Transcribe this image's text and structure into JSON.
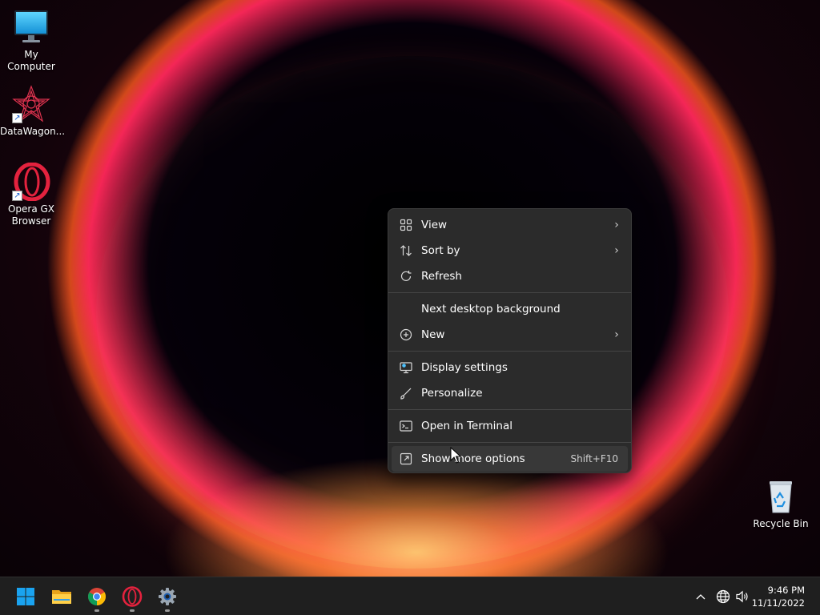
{
  "desktop": {
    "icons": [
      {
        "label": "My Computer",
        "icon": "monitor-icon"
      },
      {
        "label": "DataWagon...",
        "icon": "datawagon-logo-icon"
      },
      {
        "label": "Opera GX Browser",
        "icon": "opera-gx-icon"
      },
      {
        "label": "Recycle Bin",
        "icon": "recycle-bin-icon"
      }
    ]
  },
  "context_menu": {
    "items": [
      {
        "label": "View",
        "icon": "grid-icon",
        "has_submenu": true
      },
      {
        "label": "Sort by",
        "icon": "sort-icon",
        "has_submenu": true
      },
      {
        "label": "Refresh",
        "icon": "refresh-icon",
        "has_submenu": false
      },
      {
        "label": "Next desktop background",
        "icon": "",
        "has_submenu": false
      },
      {
        "label": "New",
        "icon": "plus-circle-icon",
        "has_submenu": true
      },
      {
        "label": "Display settings",
        "icon": "display-settings-icon",
        "has_submenu": false
      },
      {
        "label": "Personalize",
        "icon": "brush-icon",
        "has_submenu": false
      },
      {
        "label": "Open in Terminal",
        "icon": "terminal-icon",
        "has_submenu": false
      },
      {
        "label": "Show more options",
        "icon": "expand-icon",
        "shortcut": "Shift+F10",
        "hovered": true
      }
    ],
    "submenu_chevron": "›"
  },
  "taskbar": {
    "apps": [
      {
        "name": "Start",
        "icon": "windows-start-icon"
      },
      {
        "name": "File Explorer",
        "icon": "folder-icon"
      },
      {
        "name": "Google Chrome",
        "icon": "chrome-icon",
        "running": true
      },
      {
        "name": "Opera GX",
        "icon": "opera-gx-icon",
        "running": true
      },
      {
        "name": "Settings",
        "icon": "settings-gear-icon",
        "running": true
      }
    ],
    "tray": {
      "chevron": "^",
      "icons": [
        "show-hidden-icons-chevron",
        "network-globe-icon",
        "volume-icon"
      ]
    },
    "clock": {
      "time": "9:46 PM",
      "date": "11/11/2022"
    }
  },
  "colors": {
    "menu_bg": "#2b2b2b",
    "menu_hover": "#383838",
    "taskbar_bg": "#1f1f1f",
    "windows_blue": "#1aa3f0",
    "opera_red": "#e4223e"
  }
}
